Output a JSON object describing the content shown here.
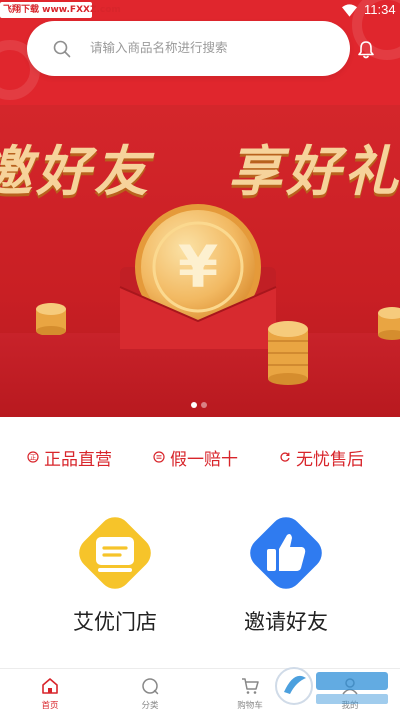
{
  "status_bar": {
    "watermark": "飞翔下载 www.FXXZ.com",
    "time": "11:34"
  },
  "search": {
    "placeholder": "请输入商品名称进行搜索"
  },
  "banner": {
    "title_left": "邀好友",
    "title_right": "享好礼",
    "slide_count": 2,
    "active_slide": 1
  },
  "guarantees": [
    {
      "label": "正品直营",
      "icon": "genuine-icon"
    },
    {
      "label": "假一赔十",
      "icon": "compensation-icon"
    },
    {
      "label": "无忧售后",
      "icon": "after-sales-icon"
    }
  ],
  "features": [
    {
      "label": "艾优门店",
      "icon": "store-icon"
    },
    {
      "label": "邀请好友",
      "icon": "thumbs-up-icon"
    }
  ],
  "bottom_nav": [
    {
      "label": "首页",
      "icon": "home-icon",
      "active": true
    },
    {
      "label": "分类",
      "icon": "category-icon",
      "active": false
    },
    {
      "label": "购物车",
      "icon": "cart-icon",
      "active": false
    },
    {
      "label": "我的",
      "icon": "profile-icon",
      "active": false
    }
  ],
  "colors": {
    "brand_red": "#d8252b",
    "banner_gold": "#f6d39b",
    "store_yellow": "#f6c42a",
    "invite_blue": "#2f7bf0"
  }
}
